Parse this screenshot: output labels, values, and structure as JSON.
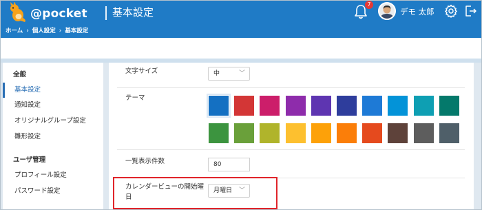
{
  "app": {
    "logo_text": "@pocket",
    "page_title": "基本設定"
  },
  "breadcrumb": [
    "ホーム",
    "個人設定",
    "基本設定"
  ],
  "breadcrumb_separator": "›",
  "header": {
    "notification_count": "7",
    "user_name": "デモ 太郎"
  },
  "sidebar": {
    "groups": [
      {
        "heading": "全般",
        "items": [
          "基本設定",
          "通知設定",
          "オリジナルグループ設定",
          "雛形設定"
        ]
      },
      {
        "heading": "ユーザ管理",
        "items": [
          "プロフィール設定",
          "パスワード設定"
        ]
      }
    ],
    "active_item": "基本設定"
  },
  "settings": {
    "font_size": {
      "label": "文字サイズ",
      "value": "中"
    },
    "theme": {
      "label": "テーマ",
      "selected": "#1470c2",
      "colors": [
        [
          "#1470c2",
          "#d33636",
          "#cc1e6a",
          "#8e2cab",
          "#5e35b1",
          "#2e3d9c",
          "#1e7ad6",
          "#0393d8",
          "#0e9fb3",
          "#04796b"
        ],
        [
          "#3c943f",
          "#6aa03a",
          "#b0b42b",
          "#fdc02f",
          "#fda109",
          "#fb7e09",
          "#e54a1e",
          "#5e423a",
          "#5d5d5d",
          "#4f5f69"
        ]
      ]
    },
    "list_count": {
      "label": "一覧表示件数",
      "value": "80"
    },
    "calendar_start": {
      "label_line1": "カレンダービューの開始曜",
      "label_line2": "日",
      "value": "月曜日"
    }
  },
  "colors": {
    "header_bg": "#1f7bc6",
    "accent": "#2a6fb5",
    "highlight_border": "#e0242a"
  },
  "icons": [
    "kangaroo-mascot-icon",
    "bell-icon",
    "gear-icon",
    "logout-icon",
    "chevron-down-icon"
  ]
}
